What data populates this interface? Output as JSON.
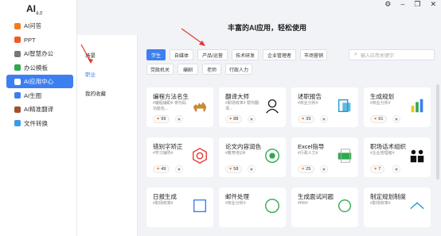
{
  "app": {
    "logo": "AI",
    "version": "4.0"
  },
  "window_controls": [
    "⚙",
    "–",
    "❐",
    "✕"
  ],
  "sidebar": {
    "items": [
      {
        "label": "AI问答",
        "color": "#f37b1d"
      },
      {
        "label": "PPT",
        "color": "#f2592a"
      },
      {
        "label": "AI智慧办公",
        "color": "#777777"
      },
      {
        "label": "办公模板",
        "color": "#2fa84f"
      },
      {
        "label": "AI应用中心",
        "color": "#ffffff",
        "active": true
      },
      {
        "label": "AI生图",
        "color": "#3d7ff0"
      },
      {
        "label": "AI精准翻译",
        "color": "#a0522d"
      },
      {
        "label": "文件转换",
        "color": "#3d9be9"
      }
    ]
  },
  "header": {
    "title": "丰富的AI应用，轻松使用"
  },
  "subnav": {
    "items": [
      {
        "label": "场景"
      },
      {
        "label": "职业",
        "active": true
      },
      {
        "label": "我的收藏"
      }
    ]
  },
  "tags": {
    "row1": [
      {
        "label": "学生",
        "active": true
      },
      {
        "label": "自媒体"
      },
      {
        "label": "产品/运营"
      },
      {
        "label": "技术研发"
      },
      {
        "label": "企业管理者"
      },
      {
        "label": "市场营销"
      }
    ],
    "row2": [
      {
        "label": "党政机关"
      },
      {
        "label": "编剧"
      },
      {
        "label": "老师"
      },
      {
        "label": "行政人力"
      }
    ]
  },
  "search": {
    "placeholder": "输入应用关键字"
  },
  "cards": [
    {
      "title": "编程方法名生",
      "desc": "#编程辅助# 将代码功能名...",
      "likes": "99",
      "icon": "camel-icon"
    },
    {
      "title": "翻译大师",
      "desc": "#职场效率# 帮你翻译...",
      "likes": "88",
      "icon": "translator-icon"
    },
    {
      "title": "述职报告",
      "desc": "#商业分析#",
      "likes": "39",
      "icon": "report-icon"
    },
    {
      "title": "生成规划",
      "desc": "#商业分析#",
      "likes": "91",
      "icon": "chart-icon"
    },
    {
      "title": "错别字矫正",
      "desc": "#学习辅导#",
      "likes": "49",
      "icon": "correction-icon"
    },
    {
      "title": "论文内容润色",
      "desc": "#教育培训#",
      "likes": "58",
      "icon": "polish-icon"
    },
    {
      "title": "Excel指导",
      "desc": "#行政人力#",
      "likes": "25",
      "icon": "excel-icon"
    },
    {
      "title": "职场话术组织",
      "desc": "#企业管理者#",
      "likes": "7",
      "icon": "people-icon"
    },
    {
      "title": "日报生成",
      "desc": "#职场效率#",
      "likes": "",
      "icon": "daily-icon"
    },
    {
      "title": "邮件处理",
      "desc": "#商业分析#",
      "likes": "",
      "icon": "mail-icon"
    },
    {
      "title": "生成面试问题",
      "desc": "#HR#",
      "likes": "",
      "icon": "interview-icon"
    },
    {
      "title": "制定规划制度",
      "desc": "#职场效率#",
      "likes": "",
      "icon": "plan-icon"
    }
  ]
}
